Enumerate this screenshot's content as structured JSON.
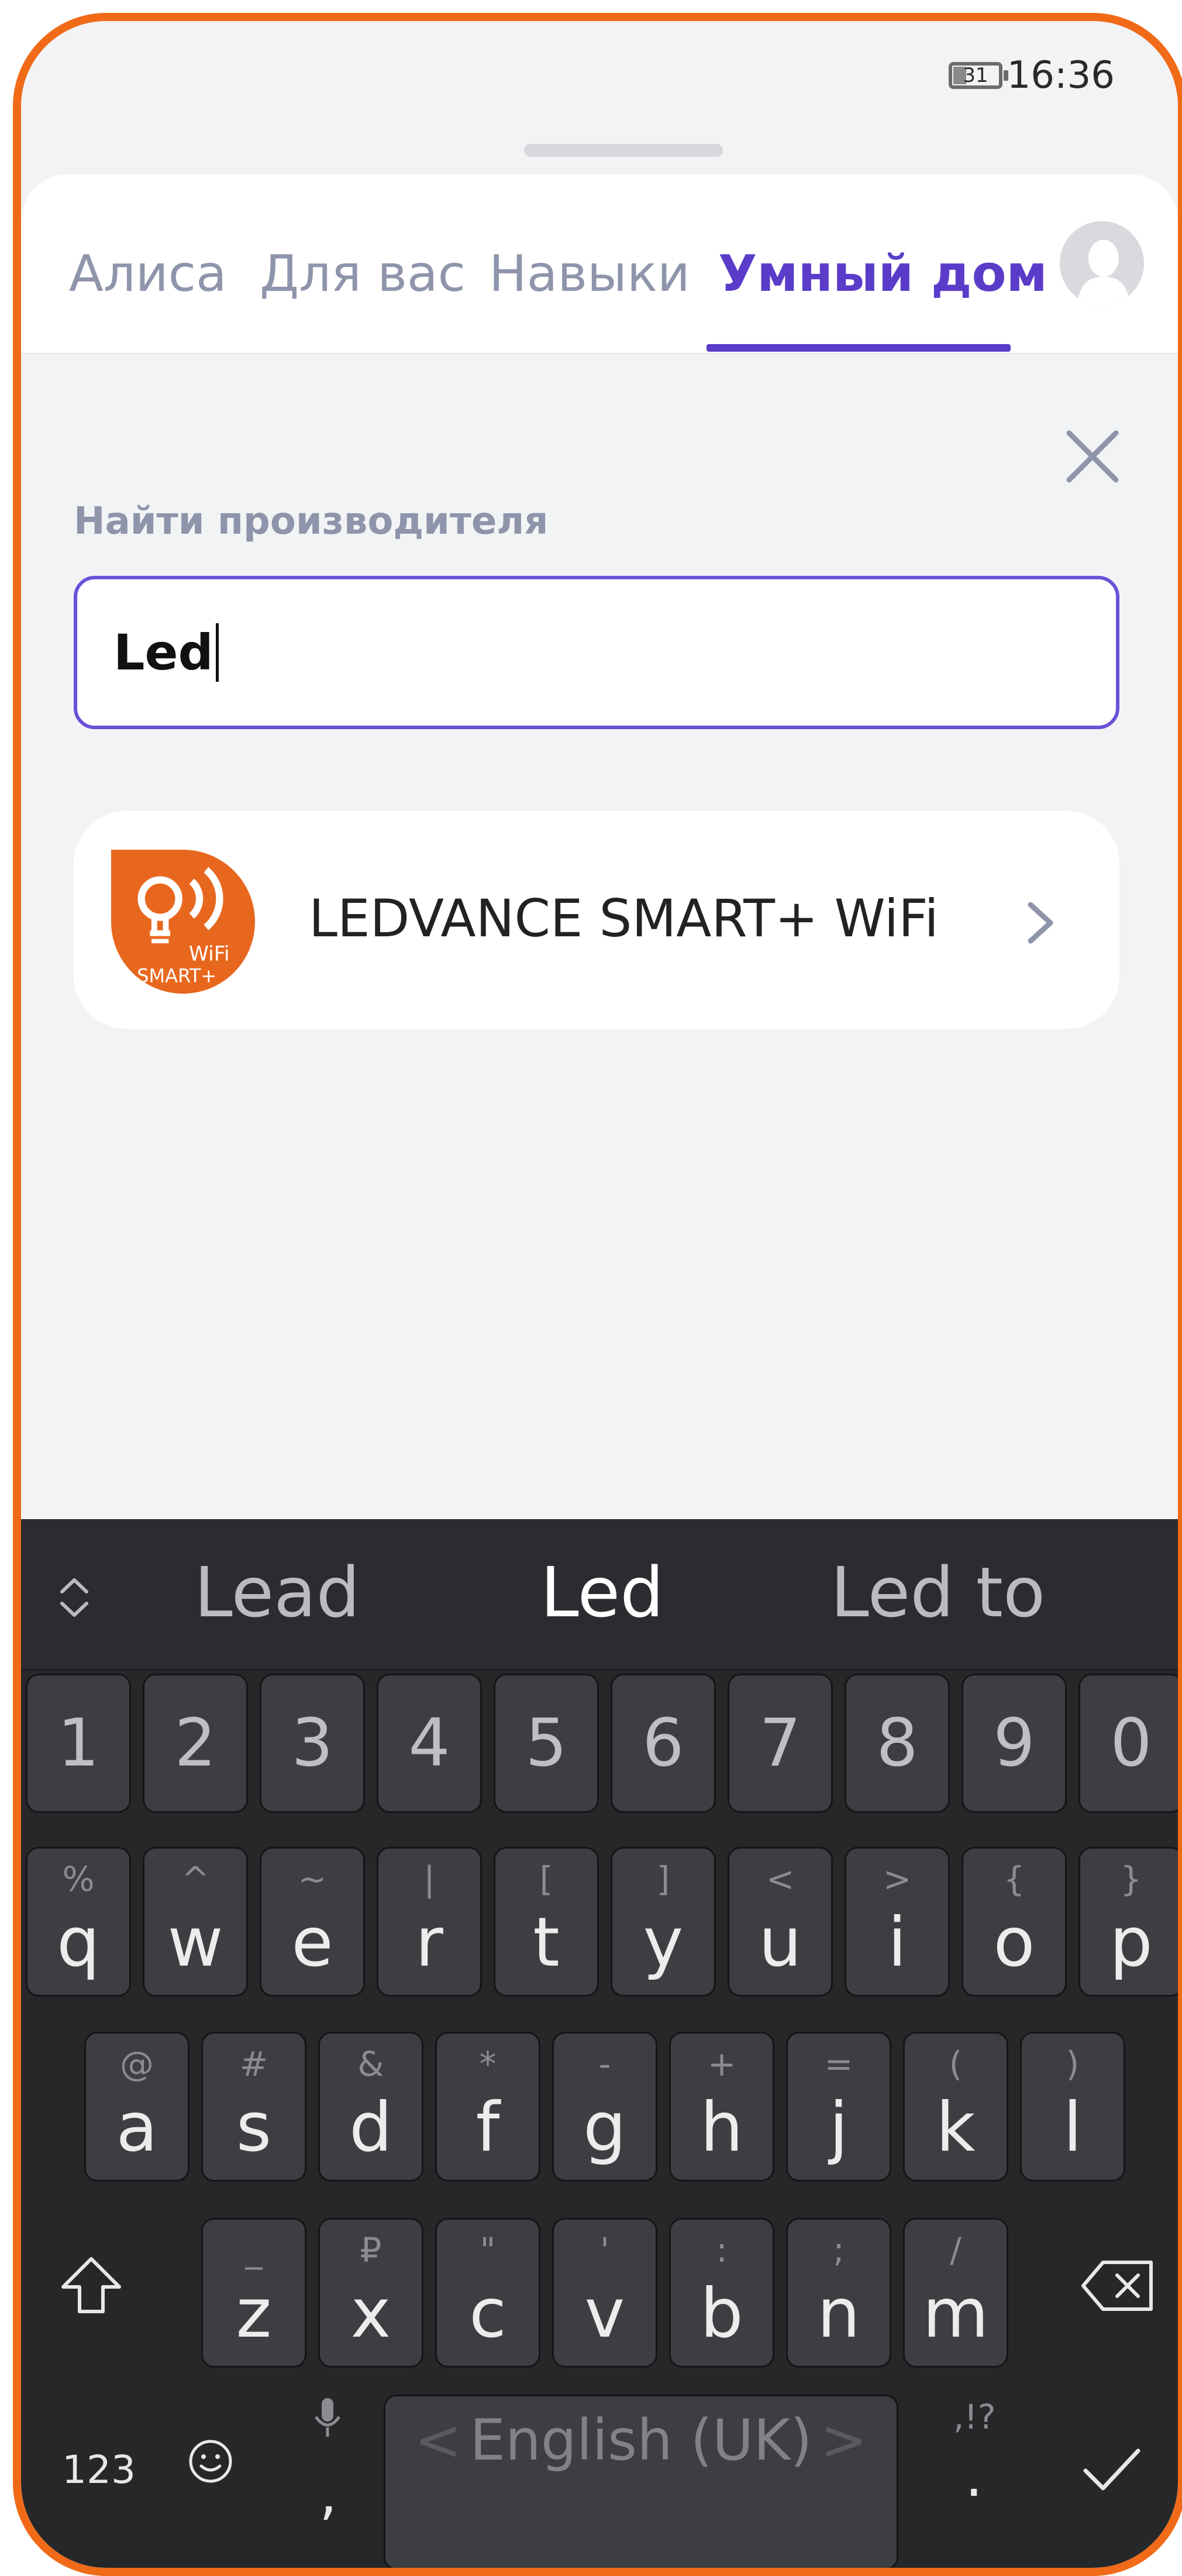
{
  "status_bar": {
    "time": "16:36",
    "battery": "31"
  },
  "tabs": [
    {
      "label": "Алиса"
    },
    {
      "label": "Для вас"
    },
    {
      "label": "Навыки"
    },
    {
      "label": "Умный дом"
    }
  ],
  "active_tab": "Умный дом",
  "search": {
    "label": "Найти производителя",
    "value": "Led"
  },
  "results": [
    {
      "title": "LEDVANCE SMART+ WiFi",
      "logo_text_top": "WiFi",
      "logo_text_bottom": "SMART+",
      "logo_color": "#e8671e"
    }
  ],
  "colors": {
    "accent": "#5a3cc9",
    "frame": "#f06a18"
  },
  "keyboard": {
    "suggestions": [
      "Lead",
      "Led",
      "Led to"
    ],
    "number_row": [
      "1",
      "2",
      "3",
      "4",
      "5",
      "6",
      "7",
      "8",
      "9",
      "0"
    ],
    "row1": [
      {
        "k": "q",
        "s": "%"
      },
      {
        "k": "w",
        "s": "^"
      },
      {
        "k": "e",
        "s": "~"
      },
      {
        "k": "r",
        "s": "|"
      },
      {
        "k": "t",
        "s": "["
      },
      {
        "k": "y",
        "s": "]"
      },
      {
        "k": "u",
        "s": "<"
      },
      {
        "k": "i",
        "s": ">"
      },
      {
        "k": "o",
        "s": "{"
      },
      {
        "k": "p",
        "s": "}"
      }
    ],
    "row2": [
      {
        "k": "a",
        "s": "@"
      },
      {
        "k": "s",
        "s": "#"
      },
      {
        "k": "d",
        "s": "&"
      },
      {
        "k": "f",
        "s": "*"
      },
      {
        "k": "g",
        "s": "-"
      },
      {
        "k": "h",
        "s": "+"
      },
      {
        "k": "j",
        "s": "="
      },
      {
        "k": "k",
        "s": "("
      },
      {
        "k": "l",
        "s": ")"
      }
    ],
    "row3": [
      {
        "k": "z",
        "s": "_"
      },
      {
        "k": "x",
        "s": "₽"
      },
      {
        "k": "c",
        "s": "\""
      },
      {
        "k": "v",
        "s": "'"
      },
      {
        "k": "b",
        "s": ":"
      },
      {
        "k": "n",
        "s": ";"
      },
      {
        "k": "m",
        "s": "/"
      }
    ],
    "numbers_key": "123",
    "comma": ",",
    "period": ".",
    "punct_hint": ",!?",
    "space_label": "English (UK)",
    "space_left": "<",
    "space_right": ">"
  }
}
